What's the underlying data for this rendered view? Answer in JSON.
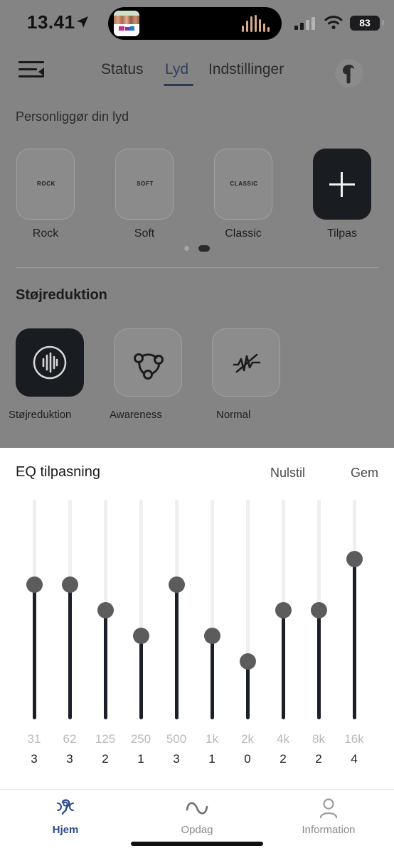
{
  "status_bar": {
    "time": "13.41",
    "location_icon": "location-arrow-icon",
    "dynamic_island": {
      "album_art": "album-art-thumbnail",
      "waveform_icon": "audio-waveform-icon"
    },
    "signal_icon": "cellular-signal-icon",
    "wifi_icon": "wifi-icon",
    "battery_level": "83"
  },
  "header": {
    "menu_icon": "menu-collapse-icon",
    "earbud_icon": "earbud-icon",
    "tabs": [
      {
        "label": "Status",
        "active": false
      },
      {
        "label": "Lyd",
        "active": true
      },
      {
        "label": "Indstillinger",
        "active": false
      }
    ]
  },
  "presets": {
    "title": "Personliggør din lyd",
    "items": [
      {
        "caption": "Rock",
        "badge": "ROCK",
        "selected": false,
        "icon": "preset-card-icon"
      },
      {
        "caption": "Soft",
        "badge": "SOFT",
        "selected": false,
        "icon": "preset-card-icon"
      },
      {
        "caption": "Classic",
        "badge": "CLASSIC",
        "selected": false,
        "icon": "preset-card-icon"
      },
      {
        "caption": "Tilpas",
        "badge": "",
        "selected": true,
        "icon": "plus-icon"
      }
    ],
    "pager": {
      "pages": 2,
      "active_index": 1
    }
  },
  "noise": {
    "title": "Støjreduktion",
    "items": [
      {
        "caption": "Støjreduktion",
        "icon": "noise-cancel-waveform-icon",
        "selected": true
      },
      {
        "caption": "Awareness",
        "icon": "awareness-nodes-icon",
        "selected": false
      },
      {
        "caption": "Normal",
        "icon": "waveform-off-icon",
        "selected": false
      }
    ]
  },
  "eq": {
    "title": "EQ tilpasning",
    "reset_label": "Nulstil",
    "save_label": "Gem",
    "max_value": 6,
    "bands": [
      {
        "freq": "31",
        "value": "3"
      },
      {
        "freq": "62",
        "value": "3"
      },
      {
        "freq": "125",
        "value": "2"
      },
      {
        "freq": "250",
        "value": "1"
      },
      {
        "freq": "500",
        "value": "3"
      },
      {
        "freq": "1k",
        "value": "1"
      },
      {
        "freq": "2k",
        "value": "0"
      },
      {
        "freq": "4k",
        "value": "2"
      },
      {
        "freq": "8k",
        "value": "2"
      },
      {
        "freq": "16k",
        "value": "4"
      }
    ]
  },
  "bottom_nav": {
    "items": [
      {
        "label": "Hjem",
        "icon": "ear-hearing-icon",
        "active": true
      },
      {
        "label": "Opdag",
        "icon": "wave-icon",
        "active": false
      },
      {
        "label": "Information",
        "icon": "person-icon",
        "active": false
      }
    ]
  },
  "colors": {
    "accent": "#2c4a8a",
    "dark_card": "#191c21",
    "overlay": "#848484",
    "track": "#1b1f29",
    "knob": "#5c5c5c"
  }
}
